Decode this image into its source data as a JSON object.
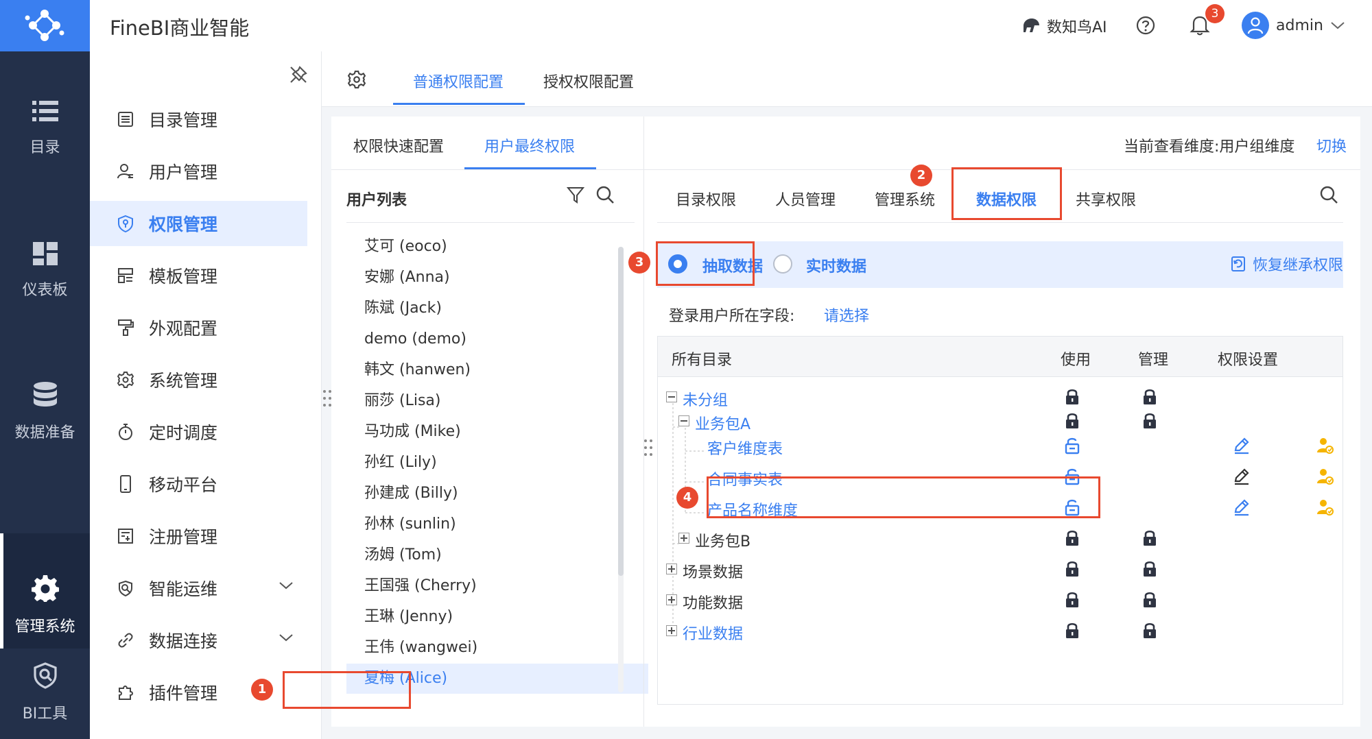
{
  "app": {
    "title": "FineBI商业智能",
    "ai_label": "数知鸟AI",
    "notification_count": "3",
    "user_name": "admin"
  },
  "rail": {
    "items": [
      {
        "label": "目录",
        "icon": "list-icon"
      },
      {
        "label": "仪表板",
        "icon": "dashboard-icon"
      },
      {
        "label": "数据准备",
        "icon": "database-icon"
      },
      {
        "label": "管理系统",
        "icon": "gear-icon",
        "active": true
      },
      {
        "label": "BI工具",
        "icon": "bi-tool-icon"
      }
    ]
  },
  "sidebar": {
    "items": [
      {
        "label": "目录管理",
        "icon": "catalog-icon"
      },
      {
        "label": "用户管理",
        "icon": "user-icon"
      },
      {
        "label": "权限管理",
        "icon": "shield-icon",
        "active": true
      },
      {
        "label": "模板管理",
        "icon": "template-icon"
      },
      {
        "label": "外观配置",
        "icon": "paint-roller-icon"
      },
      {
        "label": "系统管理",
        "icon": "settings-icon"
      },
      {
        "label": "定时调度",
        "icon": "timer-icon"
      },
      {
        "label": "移动平台",
        "icon": "mobile-icon"
      },
      {
        "label": "注册管理",
        "icon": "register-icon"
      },
      {
        "label": "智能运维",
        "icon": "ops-icon",
        "expandable": true
      },
      {
        "label": "数据连接",
        "icon": "link-icon",
        "expandable": true
      },
      {
        "label": "插件管理",
        "icon": "plugin-icon"
      }
    ]
  },
  "main_tabs": [
    {
      "label": "普通权限配置",
      "active": true
    },
    {
      "label": "授权权限配置"
    }
  ],
  "sub_tabs": [
    {
      "label": "权限快速配置"
    },
    {
      "label": "用户最终权限",
      "active": true
    }
  ],
  "dimension": {
    "label": "当前查看维度:用户组维度",
    "switch": "切换"
  },
  "user_list": {
    "title": "用户列表",
    "users": [
      "艾可 (eoco)",
      "安娜 (Anna)",
      "陈斌 (Jack)",
      "demo (demo)",
      "韩文 (hanwen)",
      "丽莎 (Lisa)",
      "马功成 (Mike)",
      "孙红 (Lily)",
      "孙建成 (Billy)",
      "孙林 (sunlin)",
      "汤姆 (Tom)",
      "王国强 (Cherry)",
      "王琳 (Jenny)",
      "王伟 (wangwei)",
      "夏梅 (Alice)"
    ],
    "selected_index": 14
  },
  "perm_tabs": [
    {
      "label": "目录权限"
    },
    {
      "label": "人员管理"
    },
    {
      "label": "管理系统"
    },
    {
      "label": "数据权限",
      "active": true
    },
    {
      "label": "共享权限"
    }
  ],
  "mode": {
    "options": [
      {
        "label": "抽取数据",
        "selected": true
      },
      {
        "label": "实时数据",
        "selected": false
      }
    ],
    "restore": "恢复继承权限"
  },
  "login_field": {
    "label": "登录用户所在字段:",
    "placeholder": "请选择"
  },
  "grid": {
    "headers": [
      "所有目录",
      "使用",
      "管理",
      "权限设置"
    ],
    "rows": [
      {
        "label": "未分组",
        "level": 0,
        "toggle": "minus",
        "blue": true,
        "use": "locked",
        "manage": "locked"
      },
      {
        "label": "业务包A",
        "level": 1,
        "toggle": "minus",
        "blue": true,
        "use": "locked",
        "manage": "locked"
      },
      {
        "label": "客户维度表",
        "level": 2,
        "blue": true,
        "use": "unlocked",
        "manage": "",
        "edit": "blue",
        "person": true
      },
      {
        "label": "合同事实表",
        "level": 2,
        "blue": true,
        "use": "unlocked",
        "manage": "",
        "edit": "dark",
        "person": true
      },
      {
        "label": "产品名称维度",
        "level": 2,
        "blue": true,
        "use": "unlocked",
        "manage": "",
        "edit": "blue",
        "person": true
      },
      {
        "label": "业务包B",
        "level": 1,
        "toggle": "plus",
        "blue": false,
        "use": "locked",
        "manage": "locked"
      },
      {
        "label": "场景数据",
        "level": 0,
        "toggle": "plus",
        "blue": false,
        "use": "locked",
        "manage": "locked"
      },
      {
        "label": "功能数据",
        "level": 0,
        "toggle": "plus",
        "blue": false,
        "use": "locked",
        "manage": "locked"
      },
      {
        "label": "行业数据",
        "level": 0,
        "toggle": "plus",
        "blue": true,
        "use": "locked",
        "manage": "locked"
      }
    ]
  },
  "steps": [
    "1",
    "2",
    "3",
    "4"
  ],
  "colors": {
    "accent": "#3a7ff0",
    "highlight": "#e8492f",
    "rail": "#23304a",
    "person_icon": "#f5b400"
  }
}
